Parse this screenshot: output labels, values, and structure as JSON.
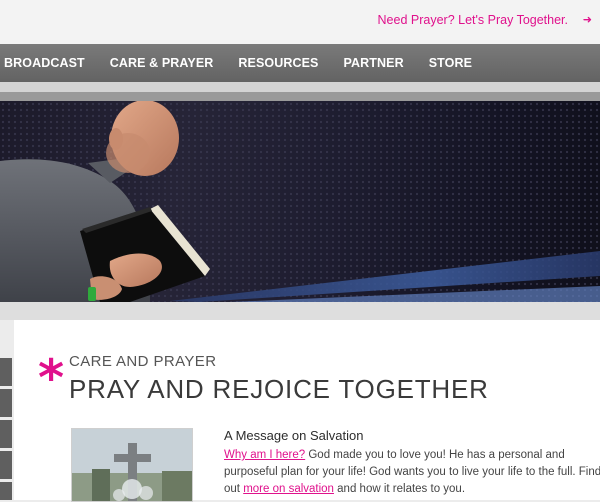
{
  "top": {
    "prayer_link": "Need Prayer? Let's Pray Together.",
    "arrow_icon": "arrow-right-icon"
  },
  "nav": {
    "items": [
      "BROADCAST",
      "CARE & PRAYER",
      "RESOURCES",
      "PARTNER",
      "STORE"
    ]
  },
  "section": {
    "kicker": "CARE AND PRAYER",
    "title": "PRAY AND REJOICE TOGETHER",
    "accent_icon": "asterisk-icon"
  },
  "message": {
    "title": "A Message on Salvation",
    "link1": "Why am I here?",
    "text1": " God made you to love you! He has a personal and",
    "text2": "purposeful plan for your life! God wants you to live your life to the full. Find",
    "text3a": "out ",
    "link2": "more on salvation",
    "text3b": " and how it relates to you."
  },
  "colors": {
    "accent": "#e0118c",
    "nav_bg": "#6b6b6b"
  }
}
